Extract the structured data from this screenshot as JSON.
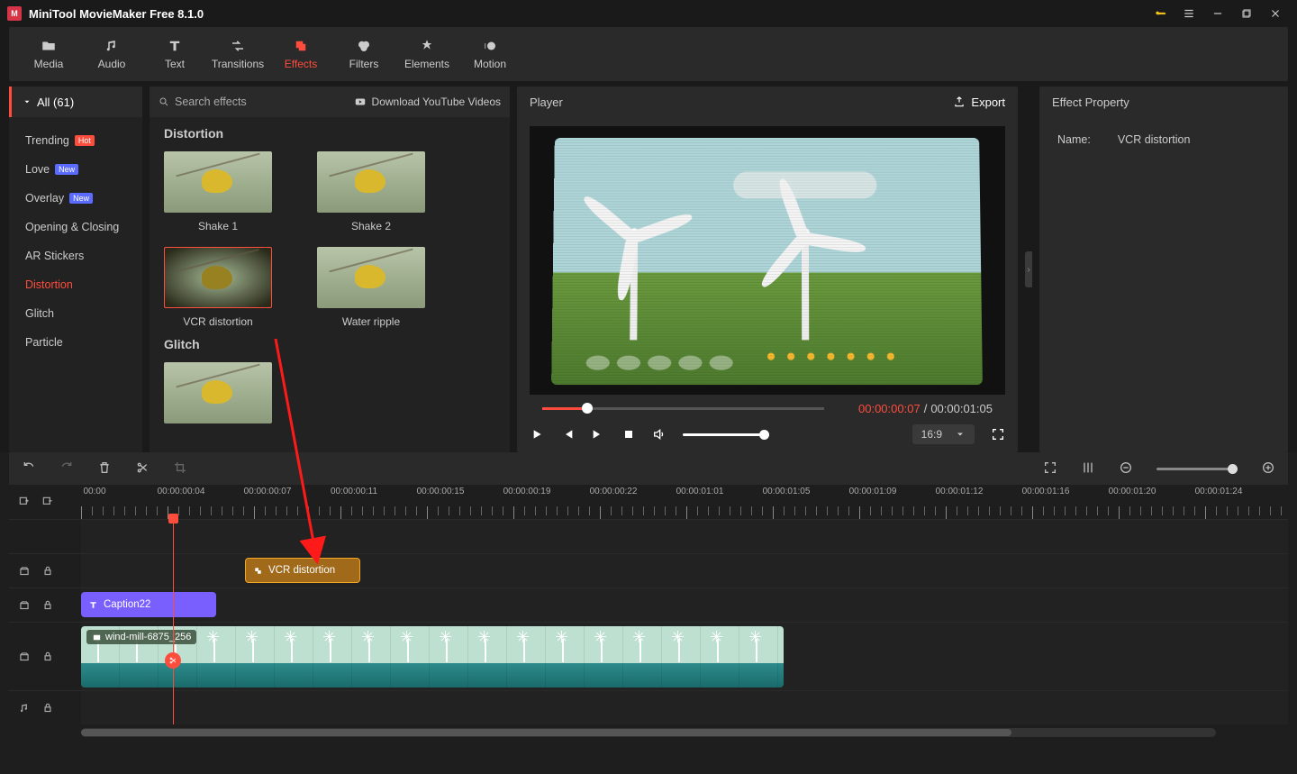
{
  "app": {
    "title": "MiniTool MovieMaker Free 8.1.0"
  },
  "ribbon": [
    {
      "id": "media",
      "label": "Media"
    },
    {
      "id": "audio",
      "label": "Audio"
    },
    {
      "id": "text",
      "label": "Text"
    },
    {
      "id": "transitions",
      "label": "Transitions"
    },
    {
      "id": "effects",
      "label": "Effects",
      "active": true
    },
    {
      "id": "filters",
      "label": "Filters"
    },
    {
      "id": "elements",
      "label": "Elements"
    },
    {
      "id": "motion",
      "label": "Motion"
    }
  ],
  "sidebar": {
    "header": "All (61)",
    "items": [
      {
        "label": "Trending",
        "badge": "Hot",
        "badgeClass": "hot"
      },
      {
        "label": "Love",
        "badge": "New",
        "badgeClass": "new"
      },
      {
        "label": "Overlay",
        "badge": "New",
        "badgeClass": "new"
      },
      {
        "label": "Opening & Closing"
      },
      {
        "label": "AR Stickers"
      },
      {
        "label": "Distortion",
        "active": true
      },
      {
        "label": "Glitch"
      },
      {
        "label": "Particle"
      }
    ]
  },
  "gallery": {
    "search_placeholder": "Search effects",
    "download_link": "Download YouTube Videos",
    "sections": [
      {
        "title": "Distortion",
        "thumbs": [
          {
            "label": "Shake 1"
          },
          {
            "label": "Shake 2"
          },
          {
            "label": "VCR distortion",
            "selected": true
          },
          {
            "label": "Water ripple"
          }
        ]
      },
      {
        "title": "Glitch",
        "thumbs": [
          {
            "label": ""
          }
        ]
      }
    ]
  },
  "player": {
    "title": "Player",
    "export": "Export",
    "current_time": "00:00:00:07",
    "total_time": "00:00:01:05",
    "ratio": "16:9"
  },
  "property": {
    "title": "Effect Property",
    "name_label": "Name:",
    "name_value": "VCR distortion"
  },
  "ruler": [
    "00:00",
    "00:00:00:04",
    "00:00:00:07",
    "00:00:00:11",
    "00:00:00:15",
    "00:00:00:19",
    "00:00:00:22",
    "00:00:01:01",
    "00:00:01:05",
    "00:00:01:09",
    "00:00:01:12",
    "00:00:01:16",
    "00:00:01:20",
    "00:00:01:24"
  ],
  "clips": {
    "effect": "VCR distortion",
    "caption": "Caption22",
    "video": "wind-mill-6875_256"
  }
}
